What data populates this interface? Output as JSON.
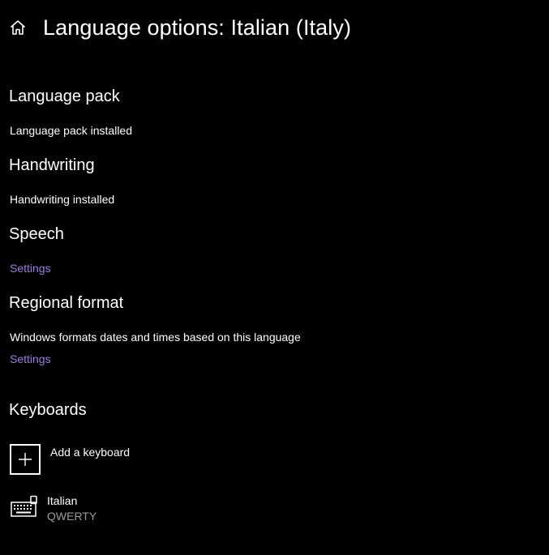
{
  "header": {
    "title": "Language options: Italian (Italy)",
    "home_icon": "home-icon"
  },
  "language_pack": {
    "heading": "Language pack",
    "status": "Language pack installed"
  },
  "handwriting": {
    "heading": "Handwriting",
    "status": "Handwriting installed"
  },
  "speech": {
    "heading": "Speech",
    "settings_link": "Settings"
  },
  "regional_format": {
    "heading": "Regional format",
    "description": "Windows formats dates and times based on this language",
    "settings_link": "Settings"
  },
  "keyboards": {
    "heading": "Keyboards",
    "add_label": "Add a keyboard",
    "add_icon": "plus-icon",
    "items": [
      {
        "name": "Italian",
        "layout": "QWERTY",
        "icon": "keyboard-icon"
      }
    ]
  },
  "colors": {
    "background": "#000000",
    "text": "#ffffff",
    "link": "#a07ae0",
    "secondary_text": "#9a9a9a"
  }
}
